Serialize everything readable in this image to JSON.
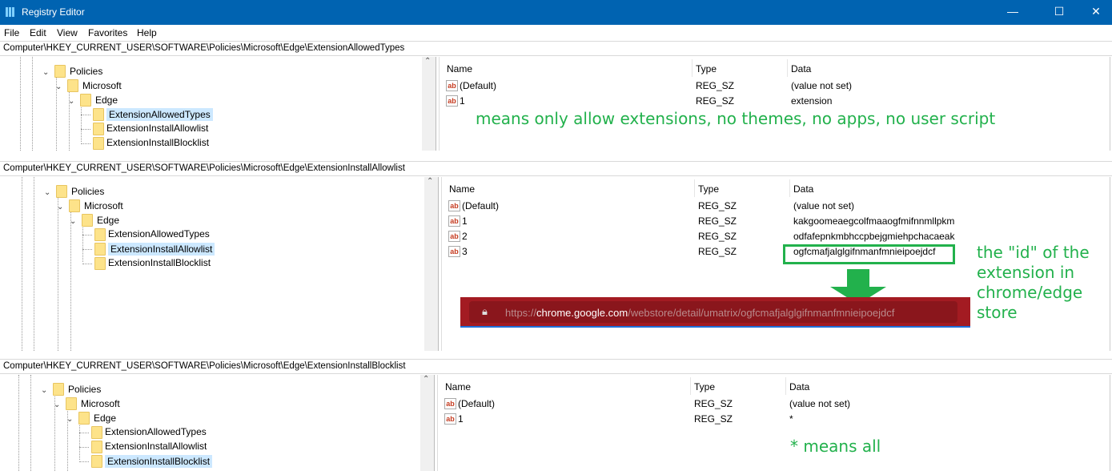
{
  "window": {
    "title": "Registry Editor",
    "minimize": "—",
    "maximize": "☐",
    "close": "✕"
  },
  "menu": [
    "File",
    "Edit",
    "View",
    "Favorites",
    "Help"
  ],
  "columns": {
    "name": "Name",
    "type": "Type",
    "data": "Data"
  },
  "panels": [
    {
      "address": "Computer\\HKEY_CURRENT_USER\\SOFTWARE\\Policies\\Microsoft\\Edge\\ExtensionAllowedTypes",
      "tree": {
        "l1": "Policies",
        "l2": "Microsoft",
        "l3": "Edge",
        "children": [
          "ExtensionAllowedTypes",
          "ExtensionInstallAllowlist",
          "ExtensionInstallBlocklist"
        ],
        "selected": 0
      },
      "values": [
        {
          "name": "(Default)",
          "type": "REG_SZ",
          "data": "(value not set)"
        },
        {
          "name": "1",
          "type": "REG_SZ",
          "data": "extension"
        }
      ]
    },
    {
      "address": "Computer\\HKEY_CURRENT_USER\\SOFTWARE\\Policies\\Microsoft\\Edge\\ExtensionInstallAllowlist",
      "tree": {
        "l1": "Policies",
        "l2": "Microsoft",
        "l3": "Edge",
        "children": [
          "ExtensionAllowedTypes",
          "ExtensionInstallAllowlist",
          "ExtensionInstallBlocklist"
        ],
        "selected": 1
      },
      "values": [
        {
          "name": "(Default)",
          "type": "REG_SZ",
          "data": "(value not set)"
        },
        {
          "name": "1",
          "type": "REG_SZ",
          "data": "kakgoomeaegcolfmaaogfmifnnmllpkm"
        },
        {
          "name": "2",
          "type": "REG_SZ",
          "data": "odfafepnkmbhccpbejgmiehpchacaeak"
        },
        {
          "name": "3",
          "type": "REG_SZ",
          "data": "ogfcmafjalglgifnmanfmnieipoejdcf"
        }
      ]
    },
    {
      "address": "Computer\\HKEY_CURRENT_USER\\SOFTWARE\\Policies\\Microsoft\\Edge\\ExtensionInstallBlocklist",
      "tree": {
        "l1": "Policies",
        "l2": "Microsoft",
        "l3": "Edge",
        "children": [
          "ExtensionAllowedTypes",
          "ExtensionInstallAllowlist",
          "ExtensionInstallBlocklist"
        ],
        "selected": 2
      },
      "values": [
        {
          "name": "(Default)",
          "type": "REG_SZ",
          "data": "(value not set)"
        },
        {
          "name": "1",
          "type": "REG_SZ",
          "data": "*"
        }
      ]
    }
  ],
  "annotations": {
    "types": "means only allow extensions, no themes, no apps, no user script",
    "id": [
      "the \"id\" of the",
      "extension in",
      "chrome/edge",
      "store"
    ],
    "all": "* means all"
  },
  "url": {
    "scheme": "https://",
    "host": "chrome.google.com",
    "path": "/webstore/detail/umatrix/ogfcmafjalglgifnmanfmnieipoejdcf"
  },
  "colors": {
    "titlebar": "#0063b1",
    "annotation": "#22b14c",
    "urlbar": "#a31b22"
  }
}
